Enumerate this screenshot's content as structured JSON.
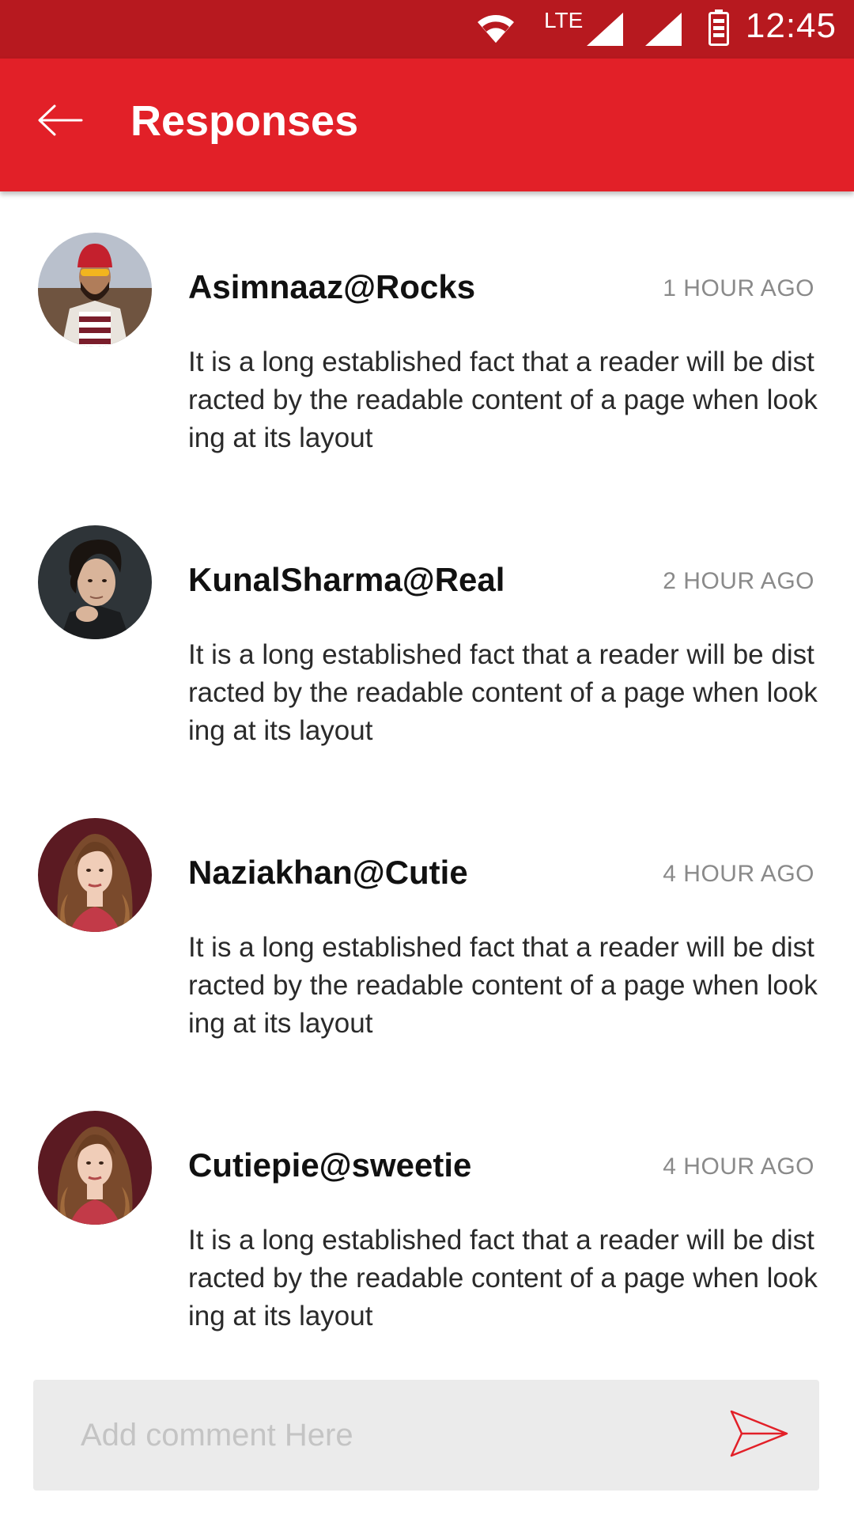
{
  "status_bar": {
    "network_label": "LTE",
    "time": "12:45"
  },
  "app_bar": {
    "title": "Responses",
    "back_icon": "arrow-left-icon"
  },
  "responses": [
    {
      "username": "Asimnaaz@Rocks",
      "time_ago": "1  HOUR AGO",
      "text": "It is a long established fact that a reader will be distracted by the readable content of a page when looking at its layout"
    },
    {
      "username": "KunalSharma@Real",
      "time_ago": "2 HOUR AGO",
      "text": "It is a long established fact that a reader will be distracted by the readable content of a page when looking at its layout"
    },
    {
      "username": "Naziakhan@Cutie",
      "time_ago": "4 HOUR AGO",
      "text": "It is a long established fact that a reader will be distracted by the readable content of a page when looking at its layout"
    },
    {
      "username": "Cutiepie@sweetie",
      "time_ago": "4 HOUR AGO",
      "text": "It is a long established fact that a reader will be distracted by the readable content of a page when looking at its layout"
    }
  ],
  "comment_bar": {
    "placeholder": "Add comment Here",
    "value": "",
    "send_icon": "send-icon"
  },
  "colors": {
    "status_bar": "#b7191f",
    "app_bar": "#e22028",
    "accent": "#e22028",
    "comment_box": "#ebebeb"
  }
}
